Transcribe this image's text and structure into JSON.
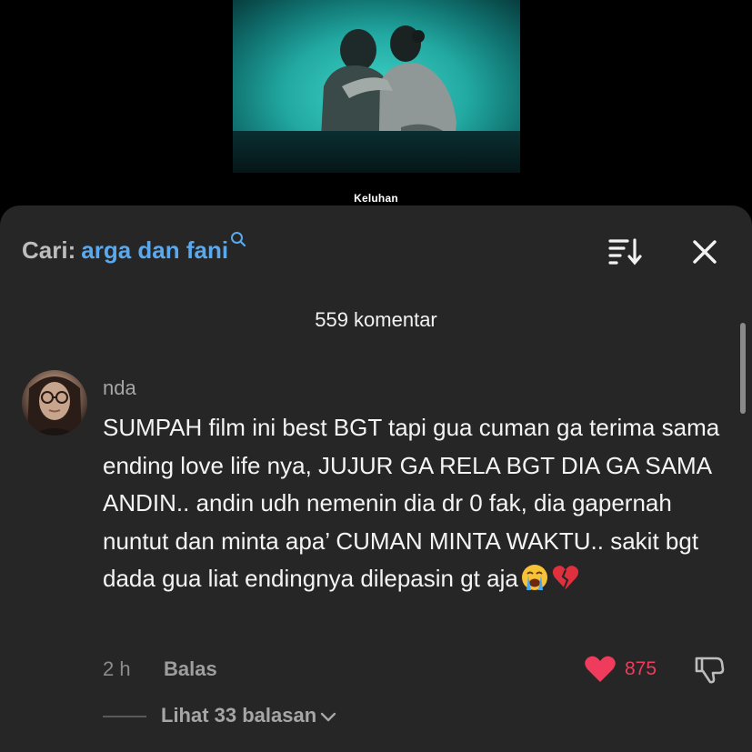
{
  "video": {
    "caption": "Keluhan"
  },
  "search": {
    "prefix": "Cari:",
    "query": "arga dan fani",
    "icon": "search-icon"
  },
  "header": {
    "sort_icon": "sort-icon",
    "close_icon": "close-icon",
    "comment_count": "559 komentar"
  },
  "comment": {
    "username": "nda",
    "text": "SUMPAH film ini best BGT tapi gua cuman ga terima sama ending love life nya, JUJUR GA RELA BGT DIA GA SAMA ANDIN.. andin udh nemenin dia dr 0 fak, dia gapernah nuntut dan minta apa’ CUMAN MINTA WAKTU.. sakit bgt dada gua liat endingnya dilepasin gt aja",
    "emojis": [
      "crying-face-emoji",
      "broken-heart-emoji"
    ],
    "time": "2 h",
    "reply_label": "Balas",
    "like_count": "875",
    "view_replies_label": "Lihat 33 balasan"
  },
  "colors": {
    "sheet_bg": "#262626",
    "search_query": "#5aa9ef",
    "like": "#ef3b5c",
    "video_tint": "#2bbfb6"
  }
}
